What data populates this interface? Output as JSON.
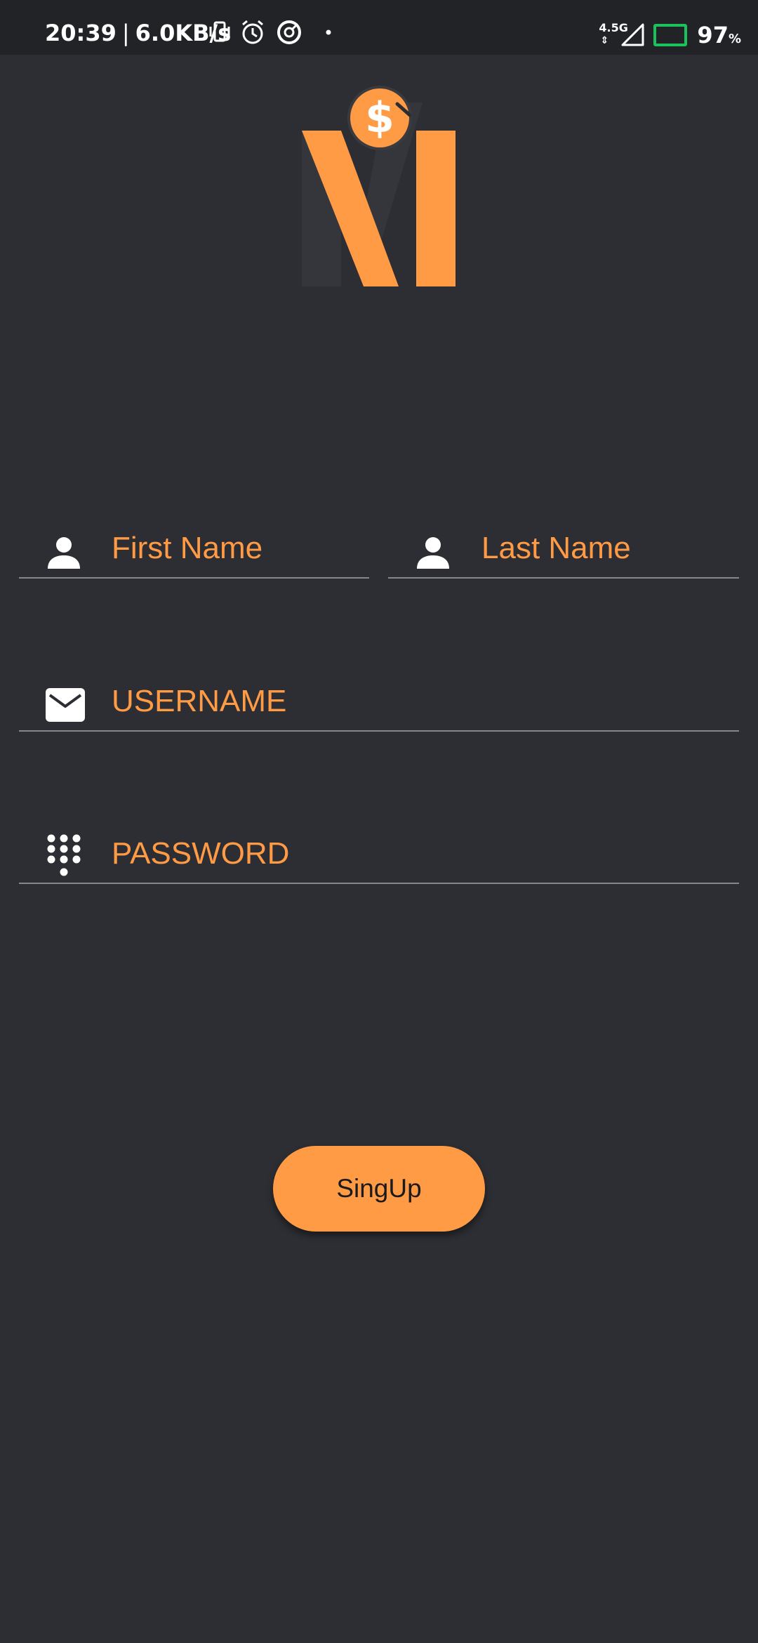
{
  "status_bar": {
    "time": "20:39",
    "separator": "|",
    "net_speed": "6.0KB/s",
    "network_type": "4.5G",
    "network_arrows": "⇕",
    "battery_percent": "97",
    "battery_unit": "%",
    "battery_color": "#19c25a",
    "icons": [
      "vibrate-icon",
      "alarm-icon",
      "data-saver-icon",
      "dot-icon",
      "signal-icon",
      "battery-icon"
    ]
  },
  "logo": {
    "symbol": "$",
    "accent_color": "#ff9a45"
  },
  "form": {
    "first_name": {
      "placeholder": "First Name",
      "icon": "person-icon"
    },
    "last_name": {
      "placeholder": "Last Name",
      "icon": "person-icon"
    },
    "username": {
      "placeholder": "USERNAME",
      "icon": "mail-icon"
    },
    "password": {
      "placeholder": "PASSWORD",
      "icon": "dialpad-icon"
    }
  },
  "signup_button": {
    "label": "SingUp"
  },
  "colors": {
    "background": "#2d2e33",
    "status_bar": "#222327",
    "accent": "#ff9a45",
    "divider": "#86878c"
  }
}
